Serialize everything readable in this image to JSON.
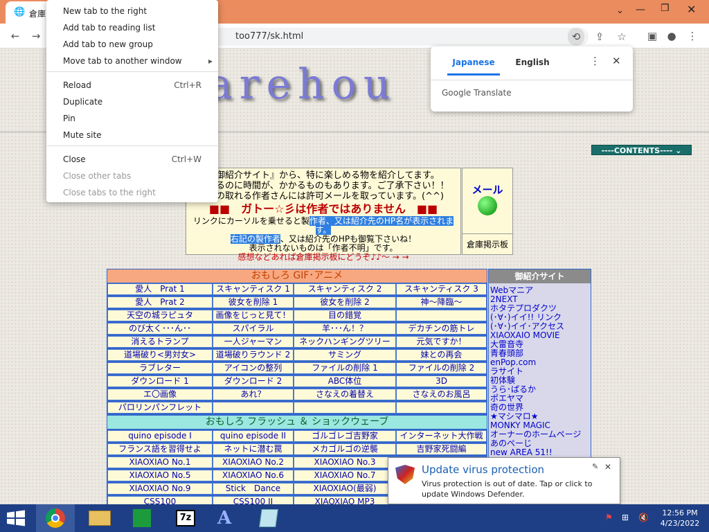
{
  "browser": {
    "tab_title": "倉庫",
    "url": "too777/sk.html"
  },
  "context_menu": {
    "items": [
      {
        "label": "New tab to the right",
        "shortcut": "",
        "disabled": false
      },
      {
        "label": "Add tab to reading list",
        "shortcut": "",
        "disabled": false
      },
      {
        "label": "Add tab to new group",
        "shortcut": "",
        "disabled": false
      },
      {
        "label": "Move tab to another window",
        "shortcut": "",
        "disabled": false
      },
      {
        "label": "Reload",
        "shortcut": "Ctrl+R",
        "disabled": false
      },
      {
        "label": "Duplicate",
        "shortcut": "",
        "disabled": false
      },
      {
        "label": "Pin",
        "shortcut": "",
        "disabled": false
      },
      {
        "label": "Mute site",
        "shortcut": "",
        "disabled": false
      },
      {
        "label": "Close",
        "shortcut": "Ctrl+W",
        "disabled": false
      },
      {
        "label": "Close other tabs",
        "shortcut": "",
        "disabled": true
      },
      {
        "label": "Close tabs to the right",
        "shortcut": "",
        "disabled": true
      }
    ]
  },
  "translate": {
    "lang_source": "Japanese",
    "lang_target": "English",
    "brand": "Google Translate"
  },
  "page": {
    "banner": "arehou",
    "contents_label": "----CONTENTS----",
    "intro_line1": "御紹介サイト』から、特に楽しめる物を紹介してます。",
    "intro_line2": "るのに時間が、かかるものもあります。ご了承下さい！！",
    "intro_line3": "の取れる作者さんには許可メールを取っています。(^^)",
    "intro_warning": "■■　ガトー☆彡は作者ではありません　■■",
    "intro_line5a": "リンクにカーソルを乗せると製",
    "intro_line5b": "作者、又は紹介先のHP名が表示されます。",
    "intro_line6a": "右記の製作者",
    "intro_line6b": "、又は紹介先のHPも御覧下さいね！",
    "intro_line7": "表示されないものは「作者不明」です。",
    "intro_line8": "感想などあれば倉庫掲示板にどうぞ♪♪〜 → →",
    "mail_label": "メール",
    "bbs_label": "倉庫掲示板",
    "section1_title": "おもしろ GIF･アニメ",
    "section2_title": "おもしろ フラッシュ ＆ ショックウェーブ",
    "grid1": [
      [
        "愛人　Prat 1",
        "スキャンティスク 1",
        "スキャンティスク 2",
        "スキャンティスク 3"
      ],
      [
        "愛人　Prat 2",
        "彼女を削除 1",
        "彼女を削除 2",
        "神〜降臨〜"
      ],
      [
        "天空の城ラピュタ",
        "画像をじっと見て！",
        "目の錯覚",
        ""
      ],
      [
        "のび太く･･･ん･･",
        "スパイラル",
        "羊･･･ん！？",
        "デカチンの筋トレ"
      ],
      [
        "消えるトランプ",
        "一人ジャーマン",
        "ネックハンギングツリー",
        "元気ですか！"
      ],
      [
        "道場破り<男対女>",
        "道場破りラウンド 2",
        "サミング",
        "妹との再会"
      ],
      [
        "ラブレター",
        "アイコンの整列",
        "ファイルの削除 1",
        "ファイルの削除 2"
      ],
      [
        "ダウンロード 1",
        "ダウンロード 2",
        "ABC体位",
        "3D"
      ],
      [
        "エ〇画像",
        "あれ？",
        "さなえの着替え",
        "さなえのお風呂"
      ],
      [
        "パロリンパンフレット",
        "",
        "",
        ""
      ]
    ],
    "grid2": [
      [
        "quino episode I",
        "quino episode II",
        "ゴルゴレゴ吉野家",
        "インターネット大作戦"
      ],
      [
        "フランス語を習得せよ",
        "ネットに潜む罠",
        "メカゴルゴの逆襲",
        "吉野家死闘編"
      ],
      [
        "XIAOXIAO No.1",
        "XIAOXIAO No.2",
        "XIAOXIAO No.3",
        ""
      ],
      [
        "XIAOXIAO No.5",
        "XIAOXIAO No.6",
        "XIAOXIAO No.7",
        ""
      ],
      [
        "XIAOXIAO No.9",
        "Stick　Dance",
        "XIAOXIAO(最弱)",
        ""
      ],
      [
        "CSS100",
        "CSS100 II",
        "XIAOXIAO MP3",
        ""
      ]
    ],
    "side_title": "御紹介サイト",
    "side_links": [
      "Webマニア",
      "2NEXT",
      "ホタテプロダクツ",
      "(･∀･)イイ!! リンク",
      "(･∀･)イイ･アクセス",
      "XIAOXAIO MOVIE",
      "大雷音寺",
      "青春頭部",
      "enPop.com",
      "ラサイト",
      "初体験",
      "うら･ぱるか",
      "ポエヤマ",
      "奇の世界",
      "★マシマロ★",
      "MONKY MAGIC",
      "オーナーのホームページ",
      "あのぺーじ",
      "new AREA 51!!"
    ]
  },
  "notification": {
    "title": "Update virus protection",
    "body": "Virus protection is out of date. Tap or click to update Windows Defender."
  },
  "taskbar": {
    "time": "12:56 PM",
    "date": "4/23/2022"
  }
}
